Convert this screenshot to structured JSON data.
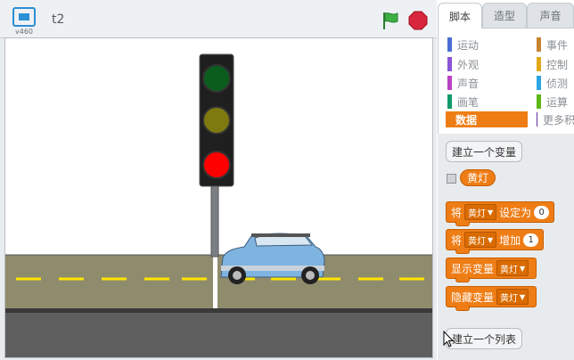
{
  "header": {
    "version": "v460",
    "project_title": "t2"
  },
  "tabs": [
    {
      "label": "脚本",
      "active": true
    },
    {
      "label": "造型",
      "active": false
    },
    {
      "label": "声音",
      "active": false
    }
  ],
  "categories_left": [
    {
      "label": "运动",
      "color": "#4a6cd4"
    },
    {
      "label": "外观",
      "color": "#8a55d7"
    },
    {
      "label": "声音",
      "color": "#bb42c3"
    },
    {
      "label": "画笔",
      "color": "#0e9a6c"
    },
    {
      "label": "数据",
      "color": "#ee7d16",
      "selected": true
    }
  ],
  "categories_right": [
    {
      "label": "事件",
      "color": "#c88330"
    },
    {
      "label": "控制",
      "color": "#e1a91a"
    },
    {
      "label": "侦测",
      "color": "#2ca5e2"
    },
    {
      "label": "运算",
      "color": "#5cb712"
    },
    {
      "label": "更多积",
      "color": "#632d99"
    }
  ],
  "palette": {
    "make_variable": "建立一个变量",
    "variable_name": "黄灯",
    "set_block": {
      "prefix": "将",
      "var": "黄灯",
      "mid": "设定为",
      "value": "0"
    },
    "change_block": {
      "prefix": "将",
      "var": "黄灯",
      "mid": "增加",
      "value": "1"
    },
    "show_block": {
      "prefix": "显示变量",
      "var": "黄灯"
    },
    "hide_block": {
      "prefix": "隐藏变量",
      "var": "黄灯"
    },
    "make_list": "建立一个列表"
  },
  "colors": {
    "accent_orange": "#ee7d16",
    "flag_green": "#3cb043",
    "stop_red": "#d7263d",
    "light_green": "#0b5d1e",
    "light_yellow": "#7f7a10",
    "light_red": "#ff0000",
    "car_blue": "#7fb3e0"
  }
}
